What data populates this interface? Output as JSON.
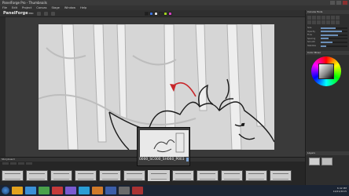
{
  "window": {
    "title": "PanelForge Pro - Thumbnails"
  },
  "menu": {
    "items": [
      "File",
      "Edit",
      "Project",
      "Canvas",
      "Stage",
      "Window",
      "Help"
    ]
  },
  "toolbar": {
    "logo": "PanelForge",
    "logo_badge": "PRO",
    "swatches": [
      "#1e1e1e",
      "#3a6fd8",
      "#d8d8d8",
      "#2a2a2a",
      "#a0d020",
      "#d040c0"
    ]
  },
  "right_panel": {
    "header": "Canvas Tools",
    "sliders": [
      {
        "label": "Size",
        "value": 0.55
      },
      {
        "label": "Opacity",
        "value": 0.8
      },
      {
        "label": "Flow",
        "value": 0.65
      },
      {
        "label": "Spacing",
        "value": 0.3
      },
      {
        "label": "Smooth",
        "value": 0.45
      },
      {
        "label": "Stabilize",
        "value": 0.2
      }
    ],
    "color_header": "Color Mixer",
    "layers_header": "Layers"
  },
  "timeline": {
    "header": "Storyboard",
    "frame_count": 12,
    "active_frame": 6
  },
  "thumbnail_popup": {
    "name": "0000_SC000_SH060_P003"
  },
  "taskbar": {
    "icons": [
      "#e2a21e",
      "#3a8fd6",
      "#4aa04a",
      "#c43a3a",
      "#7a5ad0",
      "#2a9dd4",
      "#d07a2a",
      "#3c5ea8",
      "#6a6a6a",
      "#a83232"
    ],
    "clock_time": "6:42 PM",
    "clock_date": "10/21/2015"
  },
  "colors": {
    "accent": "#6b8fb8",
    "stroke_red": "#c8262a"
  }
}
